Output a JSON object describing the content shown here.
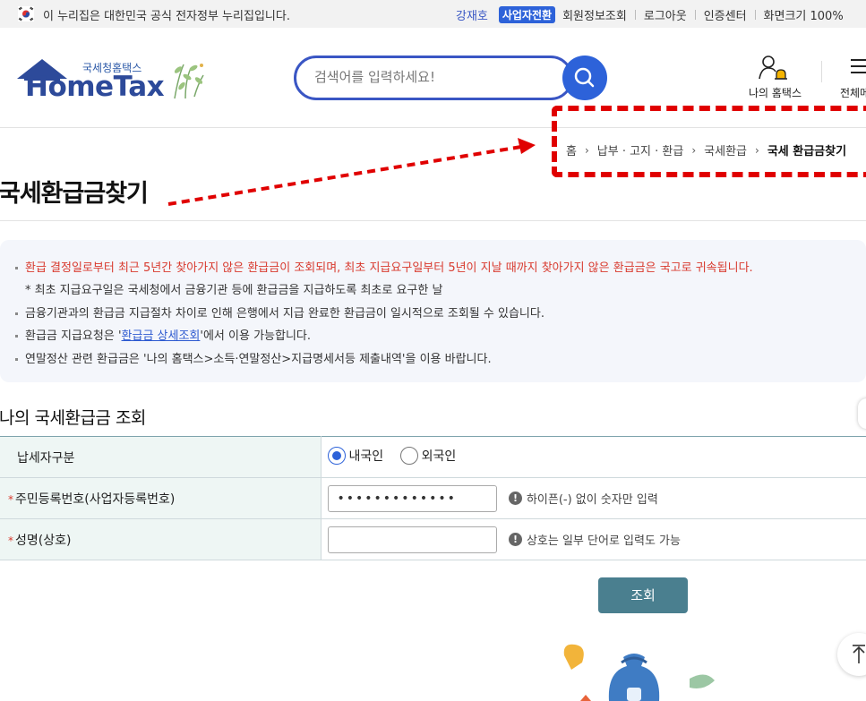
{
  "gov_bar": {
    "notice": "이 누리집은 대한민국 공식 전자정부 누리집입니다.",
    "user_name": "강재호",
    "switch_label": "사업자전환",
    "links": [
      "회원정보조회",
      "로그아웃",
      "인증센터",
      "화면크기 100%"
    ]
  },
  "header": {
    "logo_small": "국세청홈택스",
    "logo_big": "HomeTax",
    "search_placeholder": "검색어를 입력하세요!",
    "my_hometax_label": "나의 홈택스",
    "menu_label": "전체메"
  },
  "breadcrumb": {
    "items": [
      "홈",
      "납부 · 고지 · 환급",
      "국세환급",
      "국세 환급금찾기"
    ],
    "arrow": "›"
  },
  "page_title": "국세환급금찾기",
  "notice": {
    "items": [
      "환급 결정일로부터 최근 5년간 찾아가지 않은 환급금이 조회되며, 최초 지급요구일부터 5년이 지날 때까지 찾아가지 않은 환급금은 국고로 귀속됩니다.",
      "* 최초 지급요구일은 국세청에서 금융기관 등에 환급금을 지급하도록 최초로 요구한 날",
      "금융기관과의 환급금 지급절차 차이로 인해 은행에서 지급 완료한 환급금이 일시적으로 조회될 수 있습니다.",
      "환급금 지급요청은 '",
      "환급금 상세조회",
      "'에서 이용 가능합니다.",
      "연말정산 관련 환급금은 '나의 홈택스>소득·연말정산>지급명세서등 제출내역'을 이용 바랍니다."
    ]
  },
  "form": {
    "section_title": "나의 국세환급금 조회",
    "rows": {
      "taxpayer_type": {
        "label": "납세자구분",
        "options": [
          "내국인",
          "외국인"
        ],
        "selected": "내국인"
      },
      "resident_id": {
        "required_mark": "*",
        "label": "주민등록번호(사업자등록번호)",
        "value": "•••••••••••••",
        "hint_icon": "!",
        "hint": "하이픈(-) 없이 숫자만 입력"
      },
      "name": {
        "required_mark": "*",
        "label": "성명(상호)",
        "value": "",
        "hint_icon": "!",
        "hint": "상호는 일부 단어로 입력도 가능"
      }
    },
    "submit_label": "조회"
  },
  "colors": {
    "accent_blue": "#2d62d9",
    "annotation_red": "#e00000",
    "submit_teal": "#4a7f8f",
    "notice_red": "#d83a2e"
  },
  "icons": [
    "korea-flag-icon",
    "search-icon",
    "user-bell-icon",
    "hamburger-menu-icon",
    "info-icon",
    "scroll-top-icon",
    "money-bag-illustration"
  ]
}
